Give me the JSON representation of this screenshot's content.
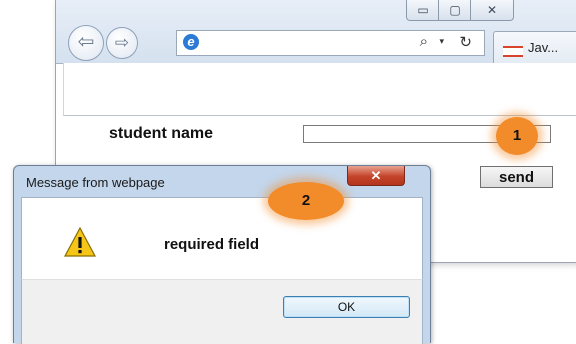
{
  "browser": {
    "window_buttons": {
      "minimize": "▭",
      "maximize": "▢",
      "close": "✕"
    },
    "address_icons": {
      "search": "⌕",
      "dropdown": "▾",
      "refresh": "↻"
    },
    "tab_label": "Jav..."
  },
  "form": {
    "label": "student name",
    "input_value": "",
    "send_label": "send"
  },
  "badges": {
    "one": "1",
    "two": "2"
  },
  "dialog": {
    "title": "Message from webpage",
    "close_glyph": "✕",
    "message": "required field",
    "ok_label": "OK"
  },
  "colors": {
    "badge": "#f28b2a",
    "dialog_frame": "#c3d6ec",
    "close_red": "#c4442a",
    "warning_yellow": "#f5c518"
  },
  "icons": [
    "back-arrow-icon",
    "forward-arrow-icon",
    "ie-logo-icon",
    "search-icon",
    "dropdown-icon",
    "refresh-icon",
    "tab-favicon-icon",
    "warning-icon"
  ]
}
